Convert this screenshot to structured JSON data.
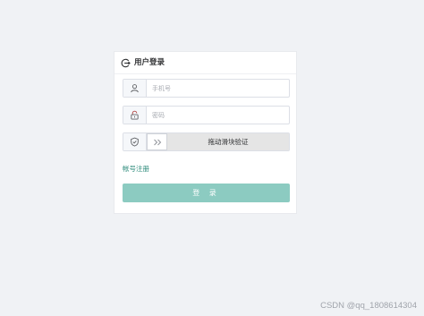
{
  "login": {
    "title": "用户登录",
    "phone_placeholder": "手机号",
    "password_placeholder": "密码",
    "slider_text": "拖动滑块验证",
    "register_link": "帐号注册",
    "submit_label": "登 录"
  },
  "watermark": "CSDN @qq_1808614304",
  "colors": {
    "page_background": "#f0f2f5",
    "accent": "#2b8a7a",
    "button_background": "#8ccbc1",
    "slider_track": "#e5e5e5"
  },
  "icons": {
    "header": "exit-icon",
    "phone_field": "user-icon",
    "password_field": "lock-icon",
    "slider_field": "shield-check-icon",
    "slider_handle": "double-chevron-right-icon"
  }
}
